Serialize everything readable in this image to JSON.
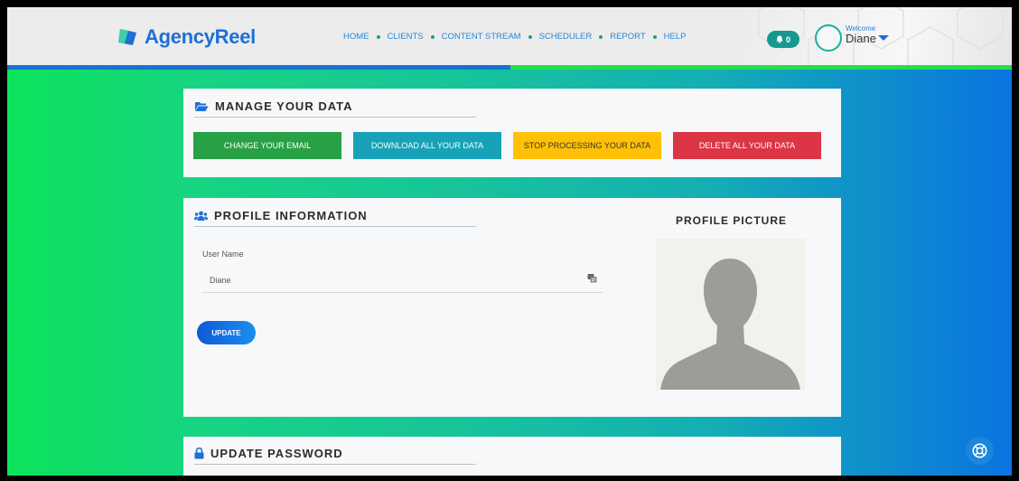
{
  "header": {
    "logo_text": "AgencyReel",
    "nav": [
      "HOME",
      "CLIENTS",
      "CONTENT STREAM",
      "SCHEDULER",
      "REPORT",
      "HELP"
    ],
    "notifications_count": "0",
    "welcome_label": "Welcome",
    "user_name": "Diane"
  },
  "manage_data": {
    "title": "MANAGE YOUR DATA",
    "buttons": {
      "change_email": "CHANGE YOUR EMAIL",
      "download": "DOWNLOAD ALL YOUR DATA",
      "stop": "STOP PROCESSING YOUR DATA",
      "delete": "DELETE ALL YOUR DATA"
    }
  },
  "profile": {
    "title": "PROFILE INFORMATION",
    "username_label": "User Name",
    "username_value": "Diane",
    "update_label": "UPDATE",
    "picture_title": "PROFILE PICTURE"
  },
  "password": {
    "title": "UPDATE PASSWORD"
  },
  "icons": {
    "logo": "agencyreel-logo",
    "bell": "bell-icon",
    "folder": "folder-open-icon",
    "users": "users-icon",
    "lock": "lock-icon",
    "field": "id-card-icon",
    "help": "life-ring-icon"
  },
  "colors": {
    "green": "#28a045",
    "teal": "#17a2b8",
    "yellow": "#ffc107",
    "red": "#dc3545",
    "brand_blue": "#1f6fd6"
  }
}
